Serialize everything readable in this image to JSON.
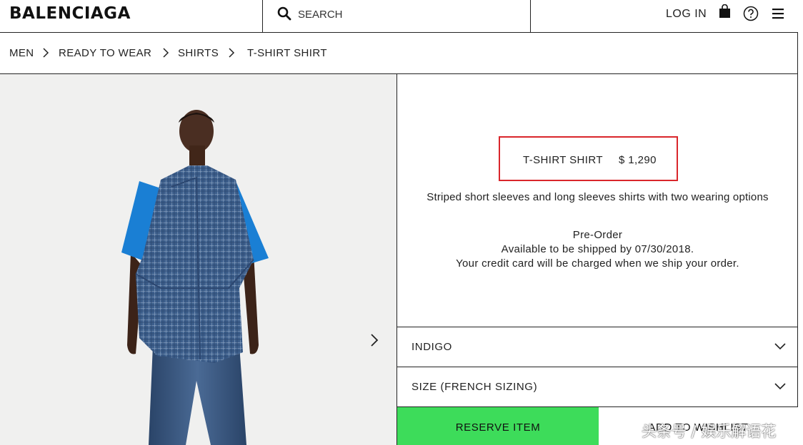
{
  "header": {
    "logo": "BALENCIAGA",
    "search_placeholder": "SEARCH",
    "login_label": "LOG IN",
    "icons": [
      "search-icon",
      "shopping-bag-icon",
      "help-icon",
      "menu-icon"
    ]
  },
  "breadcrumb": {
    "items": [
      "MEN",
      "READY TO WEAR",
      "SHIRTS",
      "T-SHIRT SHIRT"
    ]
  },
  "product": {
    "name": "T-SHIRT SHIRT",
    "price": "$ 1,290",
    "description": "Striped short sleeves and long sleeves shirts with two wearing options",
    "availability": {
      "status": "Pre-Order",
      "ship_note": "Available to be shipped by 07/30/2018.",
      "charge_note": "Your credit card will be charged when we ship your order."
    }
  },
  "options": {
    "color": "INDIGO",
    "size": "SIZE (FRENCH SIZING)"
  },
  "actions": {
    "reserve_label": "RESERVE ITEM",
    "wishlist_label": "ADD TO WISHLIST"
  },
  "watermark": "头条号 / 娱乐解语花",
  "colors": {
    "reserve_button": "#3ddc5a",
    "highlight_box": "#d9262b",
    "shirt_check": "#3d5f8c",
    "tshirt_sleeve": "#1a7fd4",
    "jeans": "#2e4a6e"
  }
}
